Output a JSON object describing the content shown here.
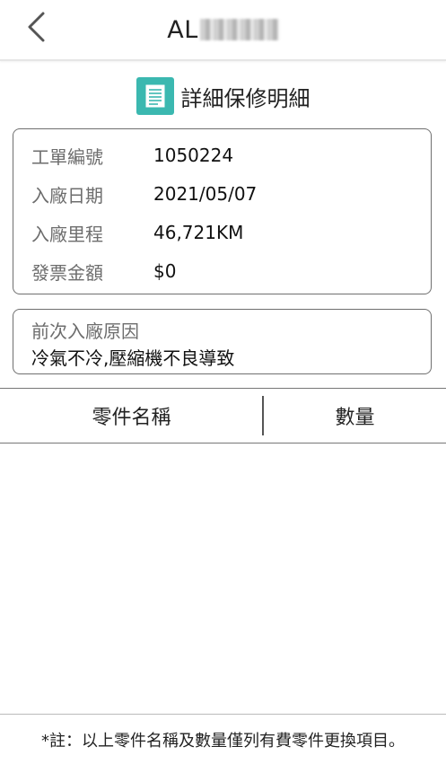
{
  "header": {
    "back_icon": "chevron-left-icon",
    "title_prefix": "AL",
    "title_redacted": "blurred-plate-number"
  },
  "section": {
    "icon": "document-icon",
    "icon_color": "#3bb8b0",
    "title": "詳細保修明細"
  },
  "info": {
    "rows": [
      {
        "label": "工單編號",
        "value": "1050224"
      },
      {
        "label": "入廠日期",
        "value": "2021/05/07"
      },
      {
        "label": "入廠里程",
        "value": "46,721KM"
      },
      {
        "label": "發票金額",
        "value": "$0"
      }
    ]
  },
  "reason": {
    "label": "前次入廠原因",
    "value": "冷氣不冷,壓縮機不良導致"
  },
  "table": {
    "columns": [
      "零件名稱",
      "數量"
    ],
    "rows": []
  },
  "footer": {
    "note": "*註：以上零件名稱及數量僅列有費零件更換項目。"
  }
}
